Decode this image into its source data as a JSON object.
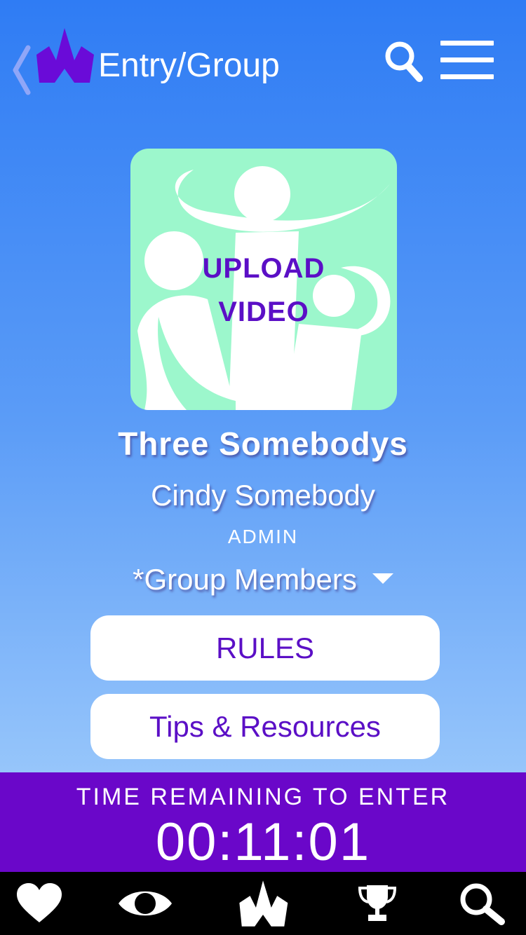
{
  "header": {
    "title": "Entry/Group",
    "back_icon": "chevron-left-icon",
    "logo_icon": "crown-logo-icon",
    "search_icon": "search-icon",
    "menu_icon": "hamburger-menu-icon"
  },
  "upload": {
    "line1": "UPLOAD",
    "line2": "VIDEO",
    "background_color": "#9cf7cc",
    "label_color": "#5b0fc6"
  },
  "group": {
    "name": "Three Somebodys",
    "member_name": "Cindy Somebody",
    "member_role": "ADMIN",
    "members_toggle": "*Group Members"
  },
  "buttons": {
    "rules": "RULES",
    "tips": "Tips & Resources"
  },
  "countdown": {
    "label": "TIME REMAINING TO ENTER",
    "time": "00:11:01",
    "background_color": "#6a07c9"
  },
  "tabbar": {
    "tabs": [
      {
        "icon": "heart-icon"
      },
      {
        "icon": "eye-icon"
      },
      {
        "icon": "crown-logo-icon"
      },
      {
        "icon": "trophy-icon"
      },
      {
        "icon": "search-icon"
      }
    ]
  },
  "colors": {
    "accent": "#5b0fc6",
    "gradient_top": "#2f7cf4",
    "gradient_bottom": "#a9d2fc"
  }
}
